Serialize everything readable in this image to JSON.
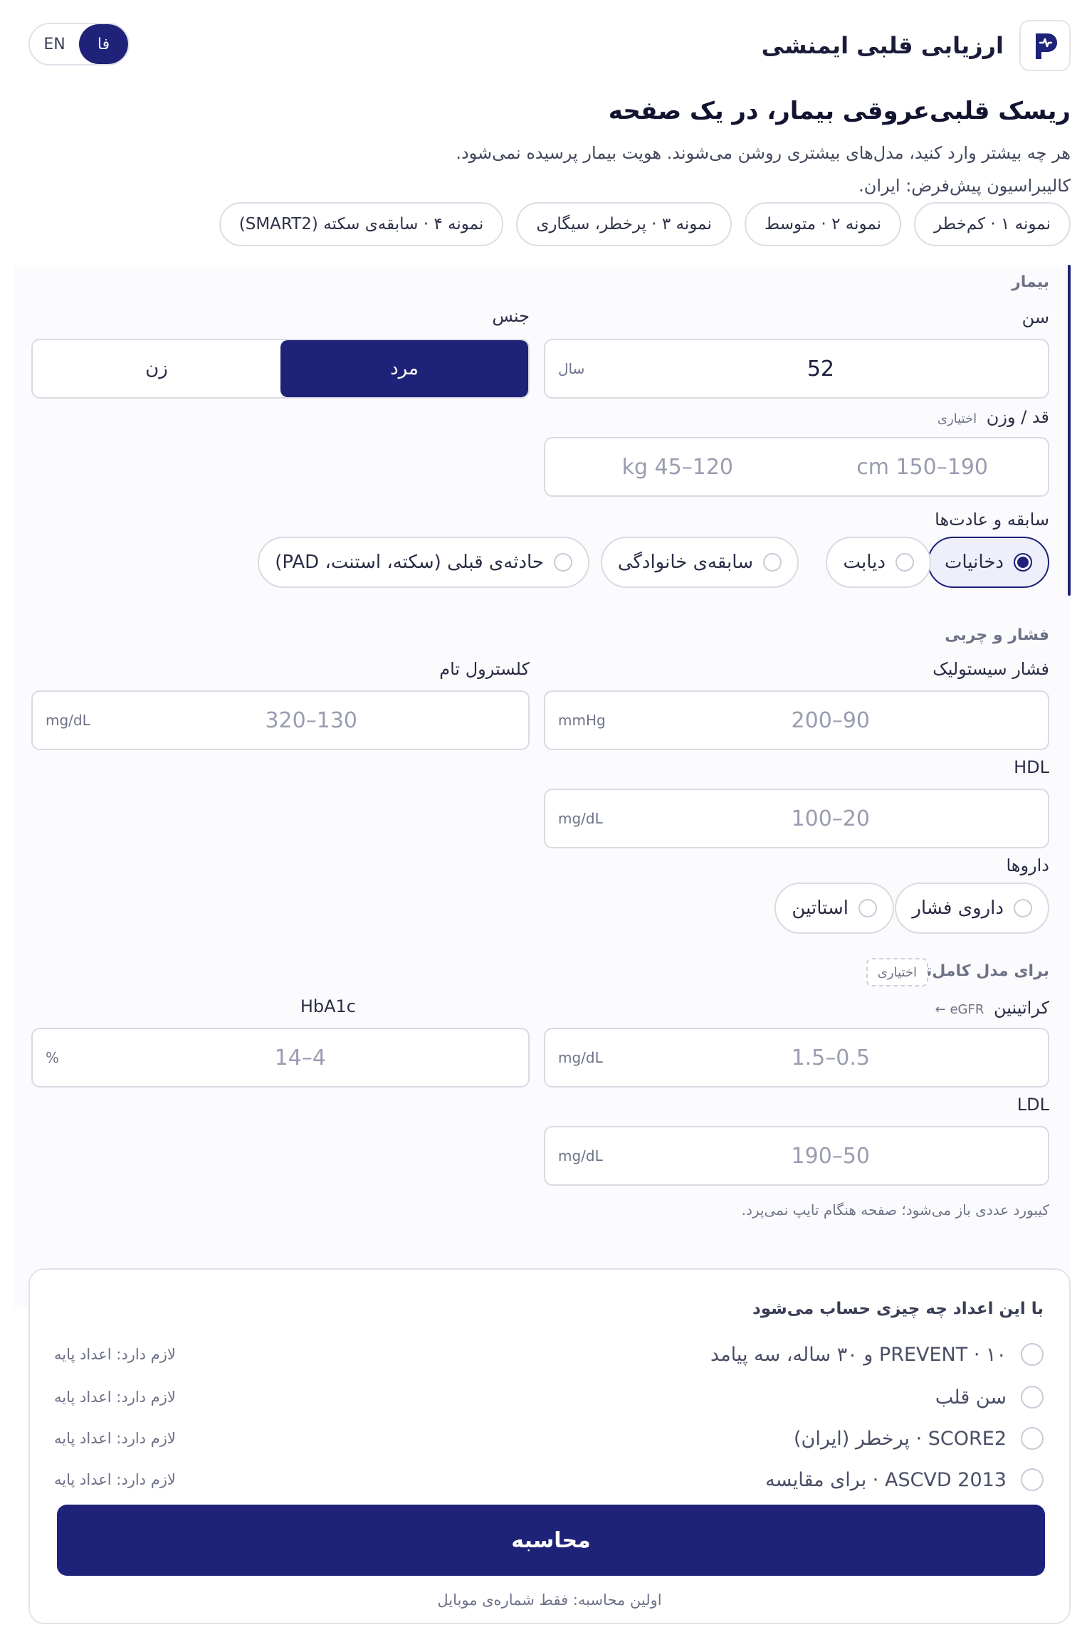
{
  "header": {
    "title": "ارزیابی قلبی ایمنشی",
    "lang_fa": "فا",
    "lang_en": "EN"
  },
  "hero": {
    "heading": "ریسک قلبی‌عروقی بیمار، در یک صفحه",
    "description": "هر چه بیشتر وارد کنید، مدل‌های بیشتری روشن می‌شوند. هویت بیمار پرسیده نمی‌شود. کالیبراسیون پیش‌فرض: ایران."
  },
  "samples": [
    "نمونه ۱ · کم‌خطر",
    "نمونه ۲ · متوسط",
    "نمونه ۳ · پرخطر، سیگاری",
    "نمونه ۴ · سابقه‌ی سکته (SMART2)"
  ],
  "patient": {
    "section": "بیمار",
    "age_label": "سن",
    "age_value": "52",
    "age_unit": "سال",
    "sex_label": "جنس",
    "sex_male": "مرد",
    "sex_female": "زن",
    "sex_selected": "male",
    "hw_label": "قد / وزن",
    "hw_optional": "اختیاری",
    "height_placeholder": "cm 150–190",
    "weight_placeholder": "kg 45–120",
    "history_label": "سابقه و عادت‌ها",
    "history": [
      {
        "label": "دخانیات",
        "checked": true
      },
      {
        "label": "دیابت",
        "checked": false
      },
      {
        "label": "سابقه‌ی خانوادگی",
        "checked": false
      },
      {
        "label": "حادثه‌ی قبلی (سکته، استنت، PAD)",
        "checked": false
      }
    ]
  },
  "pressure": {
    "section": "فشار و چربی",
    "sbp_label": "فشار سیستولیک",
    "sbp_placeholder": "90–200",
    "sbp_unit": "mmHg",
    "chol_label": "کلسترول تام",
    "chol_placeholder": "130–320",
    "chol_unit": "mg/dL",
    "hdl_label": "HDL",
    "hdl_placeholder": "20–100",
    "hdl_unit": "mg/dL",
    "meds_label": "داروها",
    "meds": [
      {
        "label": "داروی فشار",
        "checked": false
      },
      {
        "label": "استاتین",
        "checked": false
      }
    ]
  },
  "advanced": {
    "section": "برای مدل کامل‌تر",
    "optional": "اختیاری",
    "creat_label": "کراتینین",
    "creat_hint": "eGFR ←",
    "creat_placeholder": "0.5–1.5",
    "creat_unit": "mg/dL",
    "hba1c_label": "HbA1c",
    "hba1c_placeholder": "4–14",
    "hba1c_unit": "%",
    "ldl_label": "LDL",
    "ldl_placeholder": "50–190",
    "ldl_unit": "mg/dL",
    "keyboard_note": "کیبورد عددی باز می‌شود؛ صفحه هنگام تایپ نمی‌پرد."
  },
  "calc": {
    "title": "با این اعداد چه چیزی حساب می‌شود",
    "models": [
      {
        "name": "PREVENT · ۱۰ و ۳۰ ساله، سه پیامد",
        "req": "لازم دارد: اعداد پایه"
      },
      {
        "name": "سن قلب",
        "req": "لازم دارد: اعداد پایه"
      },
      {
        "name": "SCORE2 · پرخطر (ایران)",
        "req": "لازم دارد: اعداد پایه"
      },
      {
        "name": "ASCVD 2013 · برای مقایسه",
        "req": "لازم دارد: اعداد پایه"
      }
    ],
    "button": "محاسبه",
    "footnote": "اولین محاسبه: فقط شماره‌ی موبایل"
  }
}
